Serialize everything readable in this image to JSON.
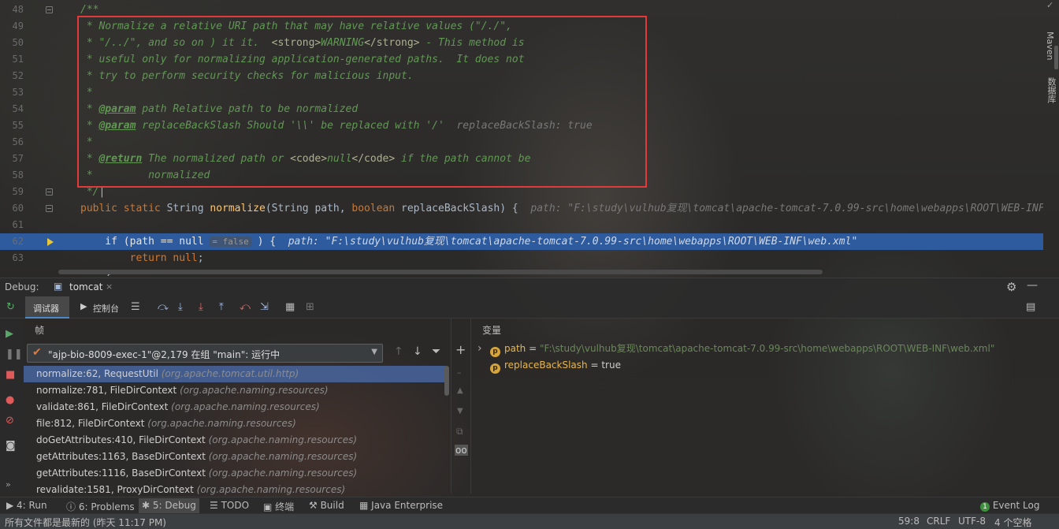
{
  "editor": {
    "lines": [
      {
        "n": "48",
        "html": "<span class='doc'>/**</span>"
      },
      {
        "n": "49",
        "html": "<span class='doc'> * Normalize a relative URI path that may have relative values (\"/./\",</span>"
      },
      {
        "n": "50",
        "html": "<span class='doc'> * \"/../\", and so on ) it it.  <span class='doc-html'>&lt;strong&gt;</span>WARNING<span class='doc-html'>&lt;/strong&gt;</span> - This method is</span>"
      },
      {
        "n": "51",
        "html": "<span class='doc'> * useful only for normalizing application-generated paths.  It does not</span>"
      },
      {
        "n": "52",
        "html": "<span class='doc'> * try to perform security checks for malicious input.</span>"
      },
      {
        "n": "53",
        "html": "<span class='doc'> *</span>"
      },
      {
        "n": "54",
        "html": "<span class='doc'> * <span class='doc-tag'>@param</span> path Relative path to be normalized</span>"
      },
      {
        "n": "55",
        "html": "<span class='doc'> * <span class='doc-tag'>@param</span> replaceBackSlash Should '\\\\' be replaced with '/'</span>  <span class='hint'>replaceBackSlash: true</span>"
      },
      {
        "n": "56",
        "html": "<span class='doc'> *</span>"
      },
      {
        "n": "57",
        "html": "<span class='doc'> * <span class='doc-tag'>@return</span> The normalized path or <span class='doc-html'>&lt;code&gt;</span>null<span class='doc-html'>&lt;/code&gt;</span> if the path cannot be</span>"
      },
      {
        "n": "58",
        "html": "<span class='doc'> *         normalized</span>"
      },
      {
        "n": "59",
        "html": "<span class='doc'> */</span><span class='plain'>|</span>"
      },
      {
        "n": "60",
        "html": "<span class='kw'>public static </span><span class='plain'>String </span><span class='fn'>normalize</span><span class='plain'>(String path, </span><span class='kw'>boolean </span><span class='plain'>replaceBackSlash) {  </span><span class='hint'>path: \"F:\\study\\vulhub复现\\tomcat\\apache-tomcat-7.0.99-src\\home\\webapps\\ROOT\\WEB-INF\\web.xml\"</span>"
      },
      {
        "n": "61",
        "html": ""
      },
      {
        "n": "62",
        "html": "<span class='kw'>    if </span><span class='plain'>(path == </span><span class='kw'>null</span> <span class='inlay'>= false</span><span class='plain'> ) {  </span><span class='hint'>path: \"F:\\study\\vulhub复现\\tomcat\\apache-tomcat-7.0.99-src\\home\\webapps\\ROOT\\WEB-INF\\web.xml\"</span>"
      },
      {
        "n": "63",
        "html": "<span class='kw'>        return null</span><span class='plain'>;</span>"
      },
      {
        "n": "",
        "html": "<span class='plain'>    }</span>"
      }
    ]
  },
  "right_strip": {
    "maven": "Maven",
    "database": "数据库"
  },
  "debug": {
    "title": "Debug:",
    "session_tab": "tomcat",
    "tab_debugger": "调试器",
    "tab_console": "控制台",
    "frames_title": "帧",
    "variables_title": "变量",
    "thread": "\"ajp-bio-8009-exec-1\"@2,179 在组 \"main\": 运行中",
    "frames": [
      {
        "method": "normalize:62, RequestUtil",
        "pkg": "(org.apache.tomcat.util.http)"
      },
      {
        "method": "normalize:781, FileDirContext",
        "pkg": "(org.apache.naming.resources)"
      },
      {
        "method": "validate:861, FileDirContext",
        "pkg": "(org.apache.naming.resources)"
      },
      {
        "method": "file:812, FileDirContext",
        "pkg": "(org.apache.naming.resources)"
      },
      {
        "method": "doGetAttributes:410, FileDirContext",
        "pkg": "(org.apache.naming.resources)"
      },
      {
        "method": "getAttributes:1163, BaseDirContext",
        "pkg": "(org.apache.naming.resources)"
      },
      {
        "method": "getAttributes:1116, BaseDirContext",
        "pkg": "(org.apache.naming.resources)"
      },
      {
        "method": "revalidate:1581, ProxyDirContext",
        "pkg": "(org.apache.naming.resources)"
      }
    ],
    "variables": [
      {
        "name": "path",
        "eq": " = ",
        "value": "\"F:\\study\\vulhub复现\\tomcat\\apache-tomcat-7.0.99-src\\home\\webapps\\ROOT\\WEB-INF\\web.xml\""
      },
      {
        "name": "replaceBackSlash",
        "eq": " = ",
        "value": "true"
      }
    ]
  },
  "bottom_tabs": {
    "run": "4: Run",
    "problems": "6: Problems",
    "debug": "5: Debug",
    "todo": "TODO",
    "terminal": "终端",
    "build": "Build",
    "java_enterprise": "Java Enterprise",
    "event_log": "Event Log",
    "event_count": "1"
  },
  "status_bar": {
    "message": "所有文件都是最新的 (昨天 11:17 PM)",
    "position": "59:8",
    "line_sep": "CRLF",
    "encoding": "UTF-8",
    "indent": "4 个空格"
  },
  "colors": {
    "accent": "#2d5b9e",
    "highlight_box": "#e03a3a",
    "string": "#6a8759",
    "keyword": "#cc7832"
  }
}
